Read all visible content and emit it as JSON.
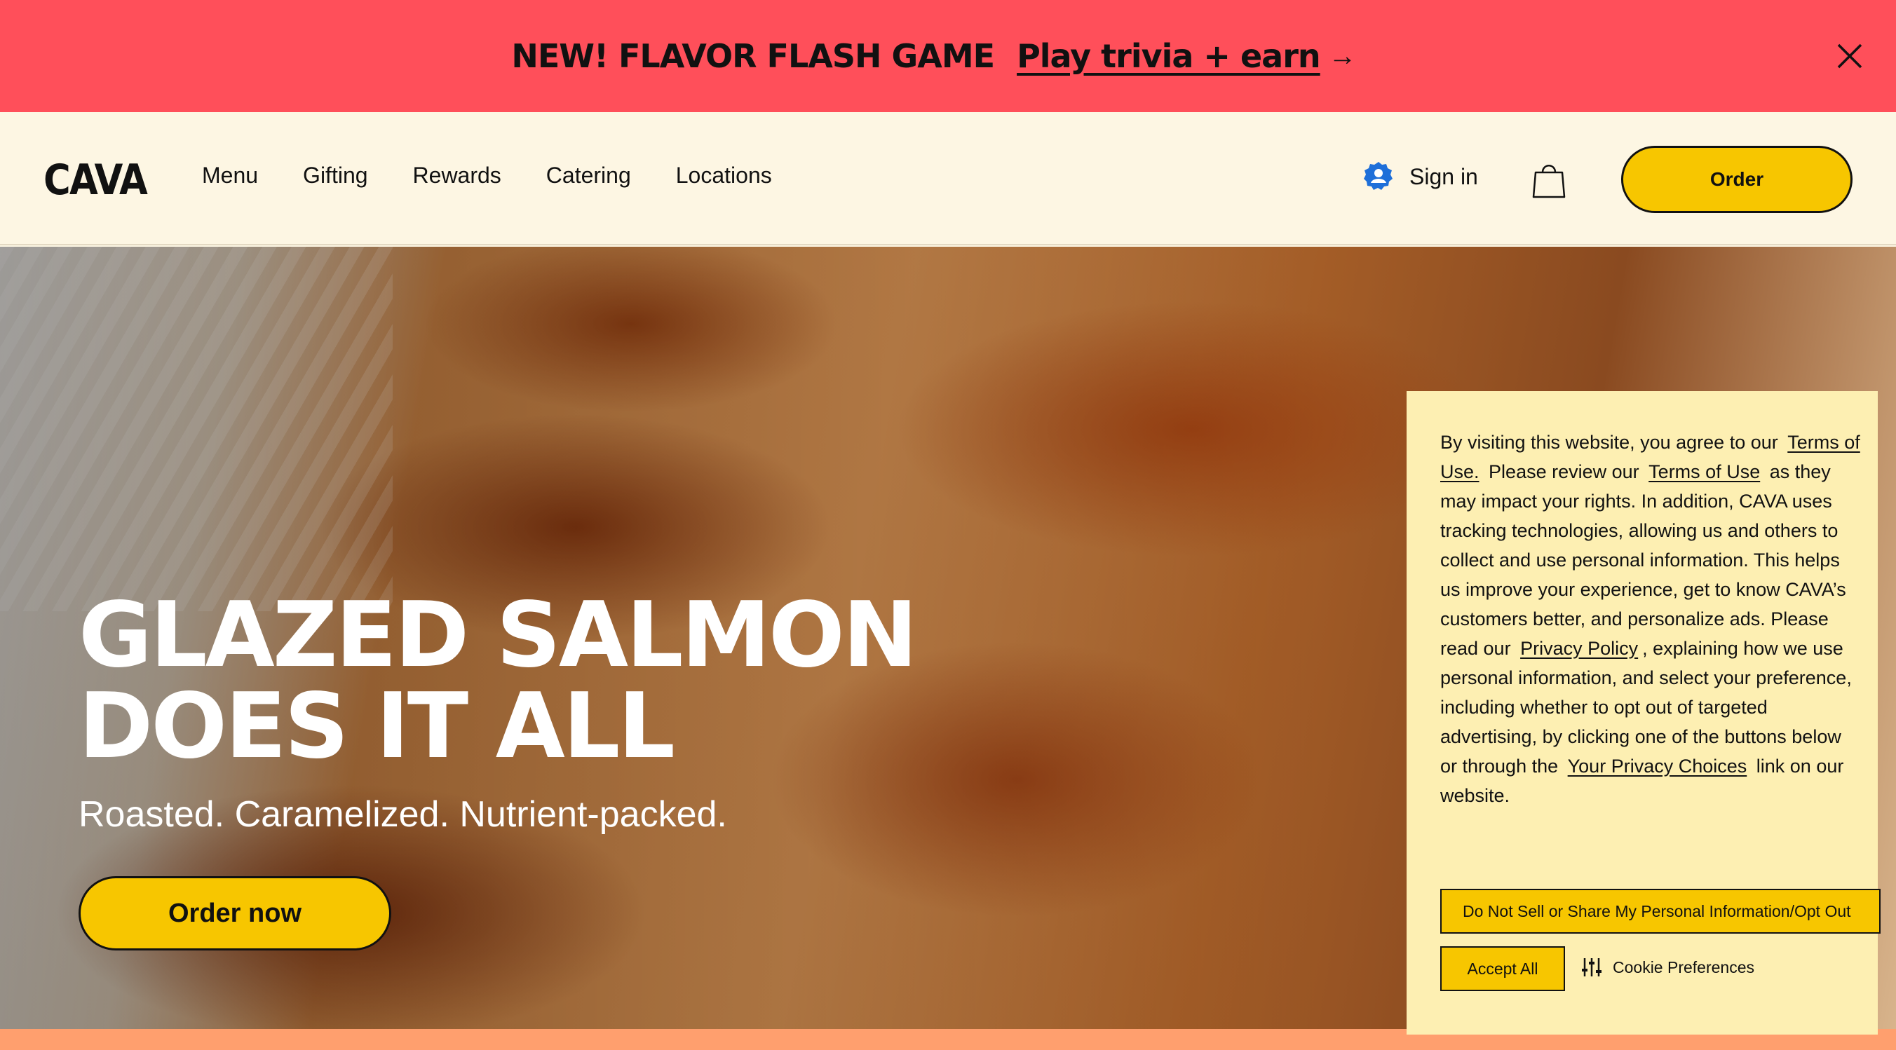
{
  "promo": {
    "title": "NEW! FLAVOR FLASH GAME",
    "link": "Play trivia + earn",
    "arrow": "→",
    "close_icon": "close-icon"
  },
  "header": {
    "logo": "CAVA",
    "nav": [
      "Menu",
      "Gifting",
      "Rewards",
      "Catering",
      "Locations"
    ],
    "sign_in": "Sign in",
    "bag_icon": "shopping-bag-icon",
    "order": "Order"
  },
  "hero": {
    "title_line1": "GLAZED SALMON",
    "title_line2": "DOES IT ALL",
    "subtitle": "Roasted. Caramelized. Nutrient-packed.",
    "cta": "Order now"
  },
  "cookie": {
    "p1": "By visiting this website, you agree to our",
    "link_terms1": "Terms of Use.",
    "p2": "Please review our",
    "link_terms2": "Terms of Use",
    "p3": "as they may impact your rights. In addition, CAVA uses tracking technologies, allowing us and others to collect and use personal information. This helps us improve your experience, get to know CAVA’s customers better, and personalize ads. Please read our",
    "link_privacy": "Privacy Policy",
    "p4": ", explaining how we use personal information, and select your preference, including whether to opt out of targeted advertising, by clicking one of the buttons below or through the",
    "link_choices": "Your Privacy Choices",
    "p5": "link on our website.",
    "opt_out": "Do Not Sell or Share My Personal Information/Opt Out",
    "accept": "Accept All",
    "preferences": "Cookie Preferences"
  },
  "colors": {
    "promo_bg": "#ff4f5a",
    "header_bg": "#fdf6e3",
    "accent_yellow": "#f7c600",
    "cookie_bg": "#fdefb2"
  }
}
